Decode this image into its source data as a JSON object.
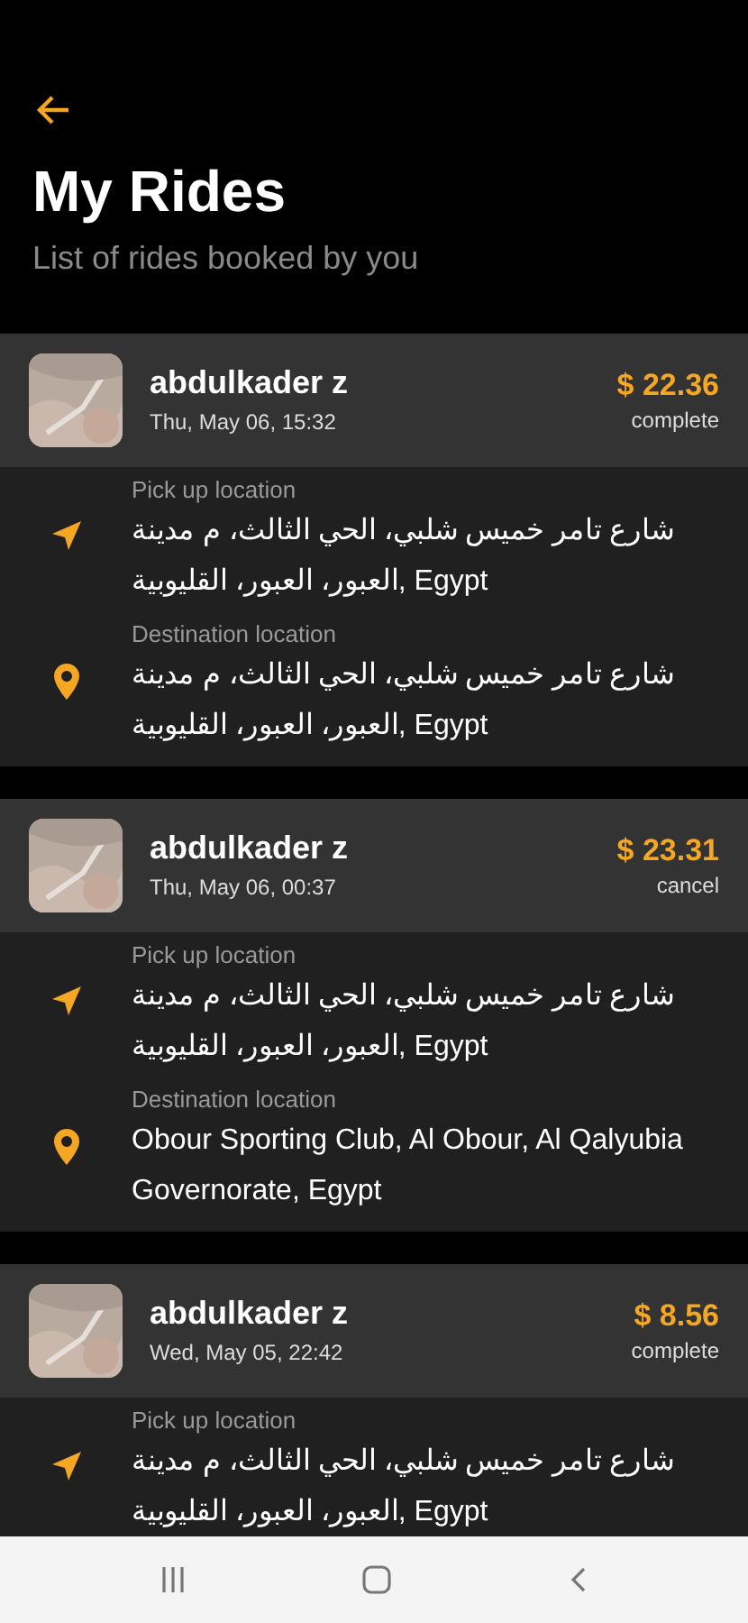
{
  "header": {
    "title": "My Rides",
    "subtitle": "List of rides booked by you"
  },
  "rides": [
    {
      "name": "abdulkader z",
      "datetime": "Thu, May 06, 15:32",
      "price": "$ 22.36",
      "status": "complete",
      "locations": [
        {
          "kind": "pickup",
          "label": "Pick up location",
          "address": "شارع تامر خميس شلبي، الحي الثالث، م مدينة العبور، العبور، القليوبية, Egypt"
        },
        {
          "kind": "destination",
          "label": "Destination location",
          "address": "شارع تامر خميس شلبي، الحي الثالث، م مدينة العبور، العبور، القليوبية, Egypt"
        }
      ]
    },
    {
      "name": "abdulkader z",
      "datetime": "Thu, May 06, 00:37",
      "price": "$ 23.31",
      "status": "cancel",
      "locations": [
        {
          "kind": "pickup",
          "label": "Pick up location",
          "address": "شارع تامر خميس شلبي، الحي الثالث، م مدينة العبور، العبور، القليوبية, Egypt"
        },
        {
          "kind": "destination",
          "label": "Destination location",
          "address": "Obour Sporting Club, Al Obour, Al Qalyubia Governorate, Egypt"
        }
      ]
    },
    {
      "name": "abdulkader z",
      "datetime": "Wed, May 05, 22:42",
      "price": "$ 8.56",
      "status": "complete",
      "locations": [
        {
          "kind": "pickup",
          "label": "Pick up location",
          "address": "شارع تامر خميس شلبي، الحي الثالث، م مدينة العبور، العبور، القليوبية, Egypt"
        }
      ]
    }
  ]
}
